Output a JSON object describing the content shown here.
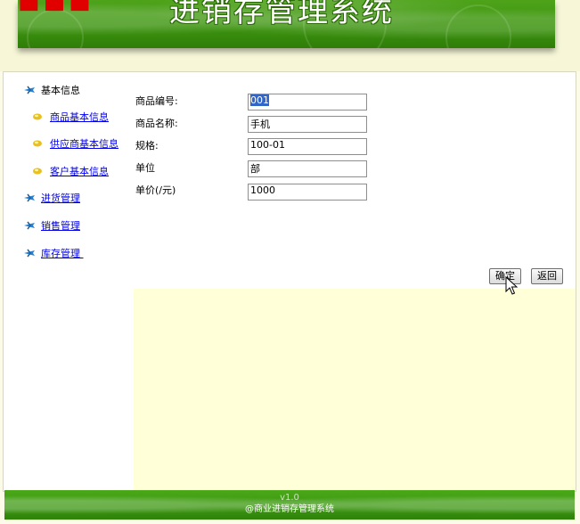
{
  "header": {
    "title": "进销存管理系统"
  },
  "sidebar": {
    "basic_info": "基本信息",
    "sub_items": [
      {
        "label": "商品基本信息"
      },
      {
        "label": "供应商基本信息"
      },
      {
        "label": "客户基本信息"
      }
    ],
    "purchase": "进货管理",
    "sales": "销售管理",
    "inventory": "库存管理 "
  },
  "form": {
    "fields": [
      {
        "label": "商品编号:",
        "value": "001"
      },
      {
        "label": "商品名称:",
        "value": "手机"
      },
      {
        "label": "规格:",
        "value": "100-01"
      },
      {
        "label": "单位",
        "value": "部"
      },
      {
        "label": "单价(/元)",
        "value": "1000"
      }
    ],
    "confirm_label": "确定",
    "back_label": "返回"
  },
  "footer": {
    "version": "v1.0",
    "copyright": "@商业进销存管理系统"
  },
  "colors": {
    "banner_green": "#3d9410",
    "content_yellow": "#ffffd8",
    "link_blue": "#0000ee"
  }
}
